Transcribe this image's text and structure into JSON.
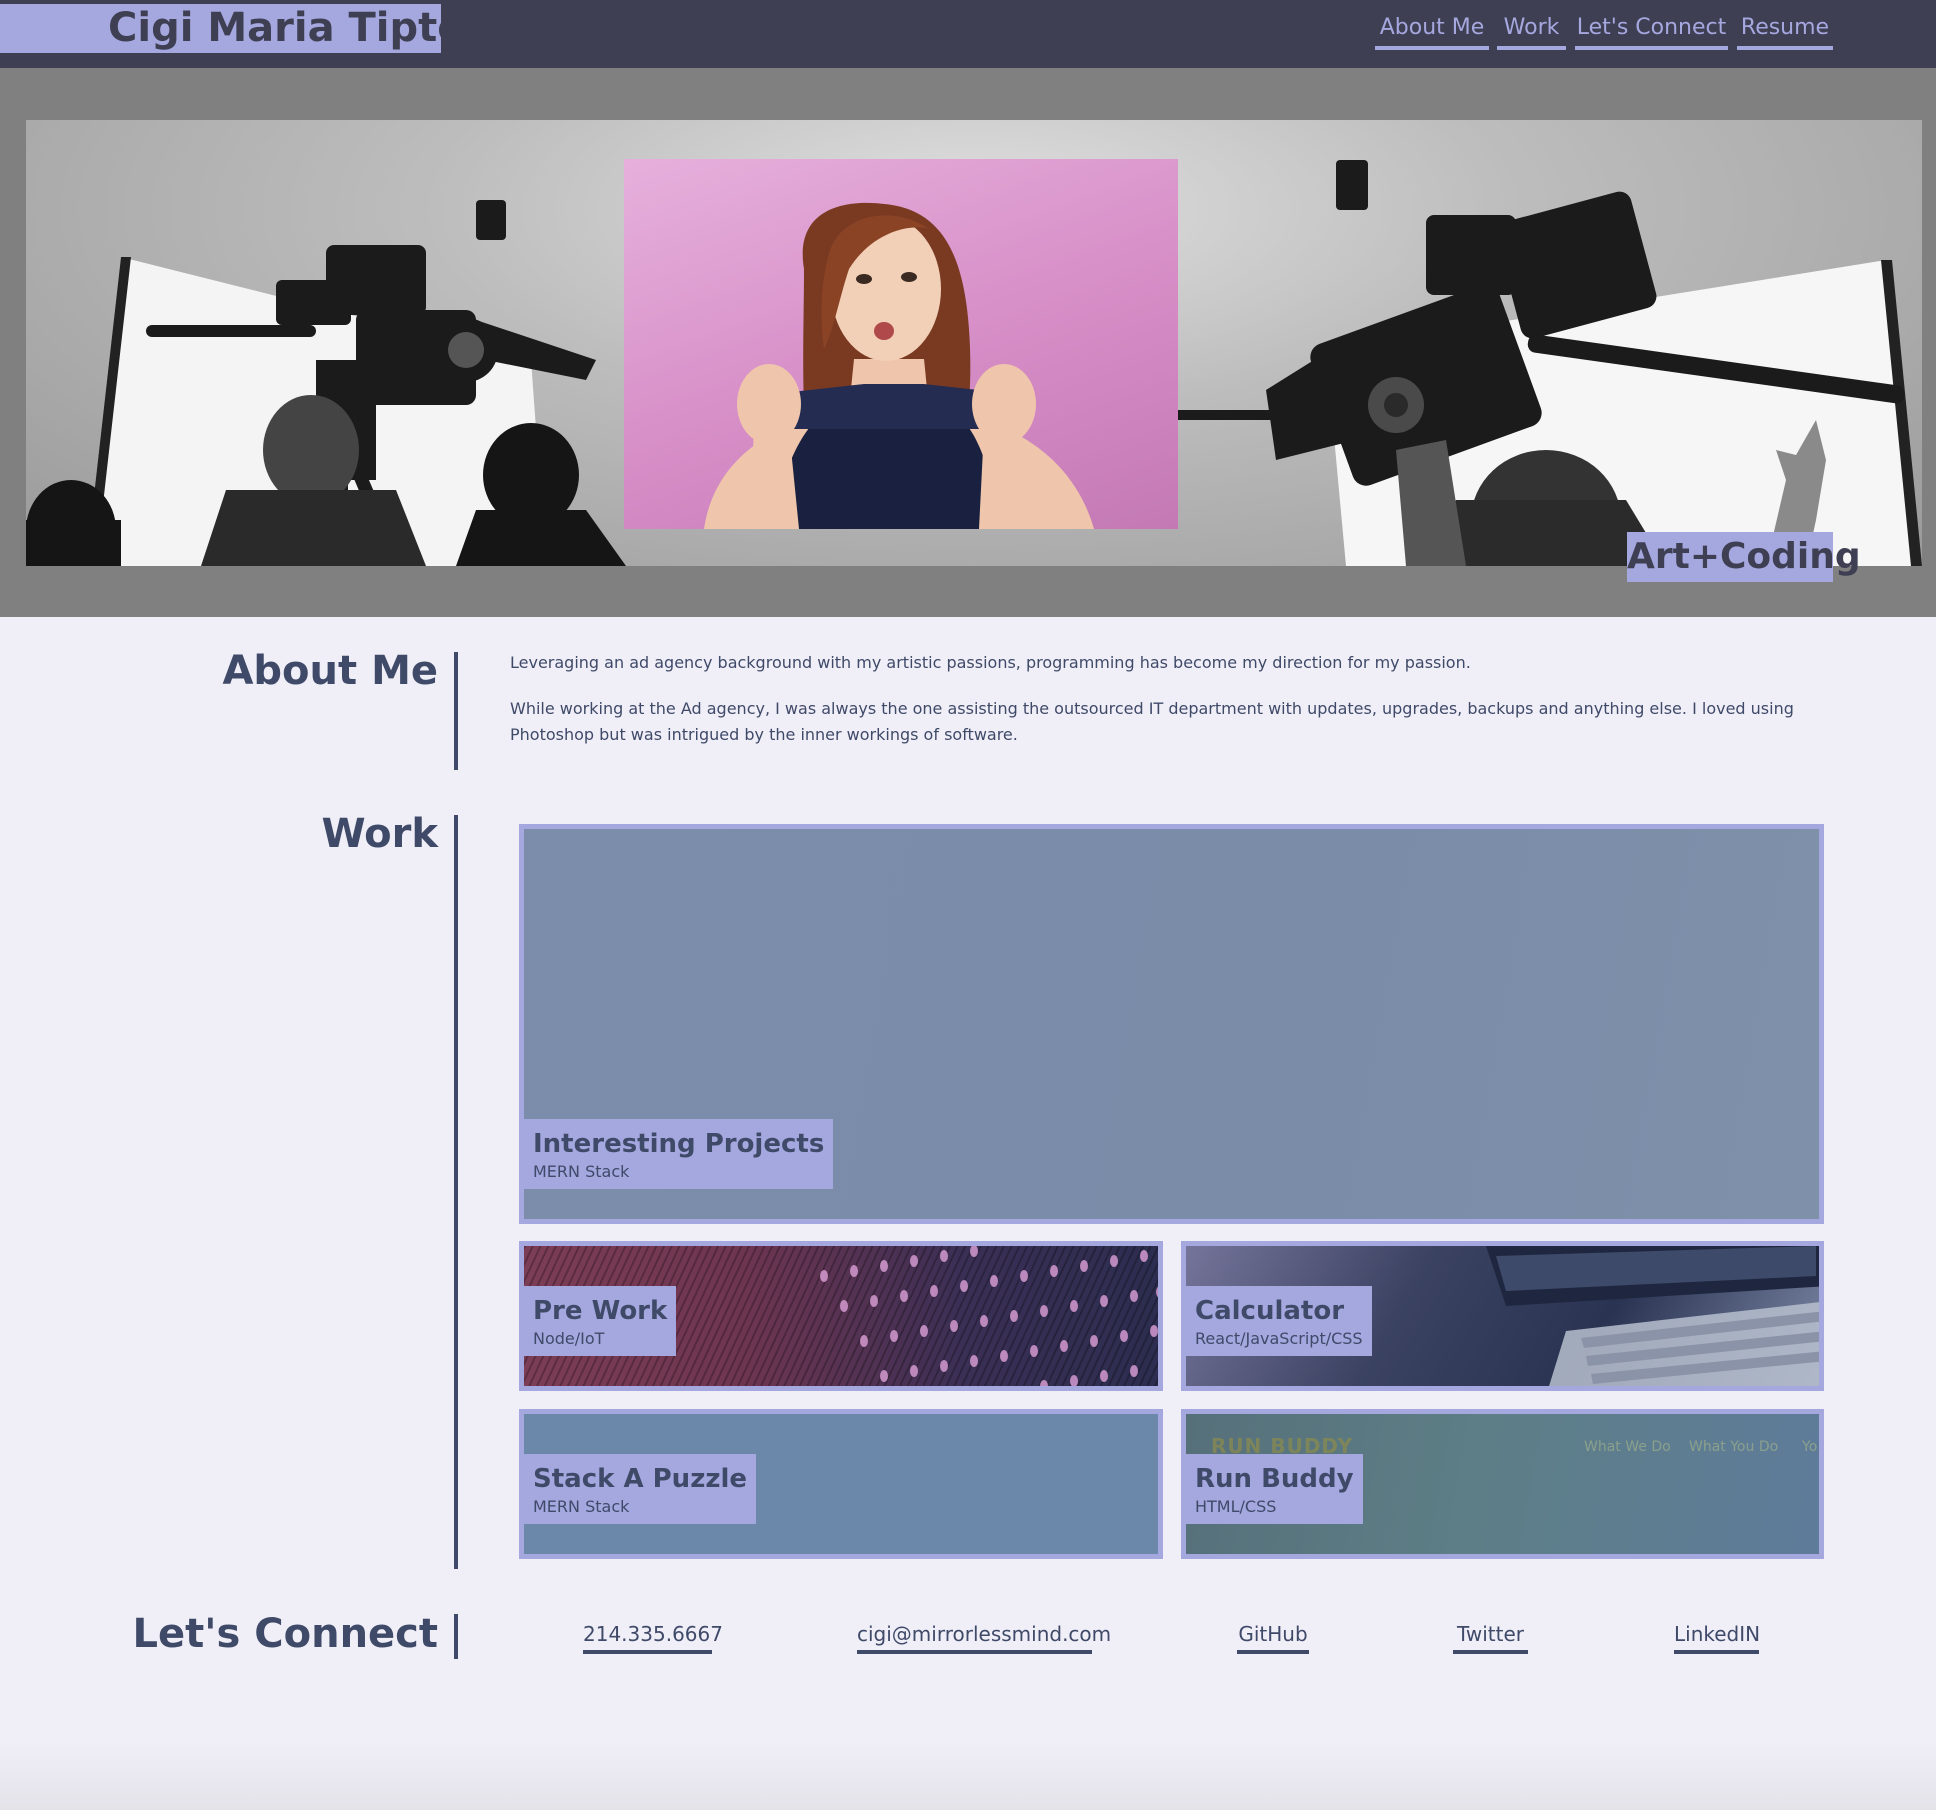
{
  "header": {
    "site_title": "Cigi Maria Tipton",
    "nav": [
      {
        "label": "About Me"
      },
      {
        "label": "Work"
      },
      {
        "label": "Let's Connect"
      },
      {
        "label": "Resume"
      }
    ]
  },
  "hero": {
    "badge": "Art+Coding",
    "run_buddy_preview": {
      "brand": "RUN BUDDY",
      "nav": [
        "What We Do",
        "What You Do",
        "Yo"
      ]
    }
  },
  "about": {
    "heading": "About Me",
    "paragraphs": [
      "Leveraging an ad agency background with my artistic passions, programming has become my direction for my passion.",
      "While working at the Ad agency, I was always the one assisting the outsourced IT department with updates, upgrades, backups and anything else. I loved using Photoshop but was intrigued by the inner workings of software."
    ]
  },
  "work": {
    "heading": "Work",
    "projects": [
      {
        "title": "Interesting Projects",
        "stack": "MERN Stack"
      },
      {
        "title": "Pre Work",
        "stack": "Node/IoT"
      },
      {
        "title": "Calculator",
        "stack": "React/JavaScript/CSS"
      },
      {
        "title": "Stack A Puzzle",
        "stack": "MERN Stack"
      },
      {
        "title": "Run Buddy",
        "stack": "HTML/CSS"
      }
    ]
  },
  "connect": {
    "heading": "Let's Connect",
    "links": [
      {
        "label": "214.335.6667"
      },
      {
        "label": "cigi@mirrorlessmind.com"
      },
      {
        "label": "GitHub"
      },
      {
        "label": "Twitter"
      },
      {
        "label": "LinkedIN"
      }
    ]
  },
  "colors": {
    "header_bg": "#3f3f53",
    "accent": "#a5a7df",
    "text": "#3f4a69",
    "page_bg": "#f0eef7",
    "hero_bg": "#808080"
  }
}
